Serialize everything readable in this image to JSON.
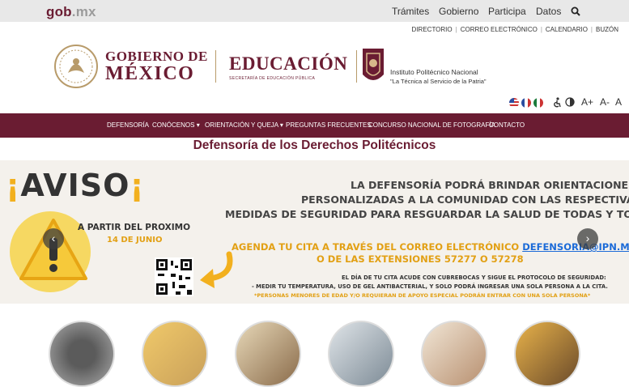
{
  "gob": {
    "brand": "gob",
    "tld": ".mx"
  },
  "topnav": {
    "tramites": "Trámites",
    "gobierno": "Gobierno",
    "participa": "Participa",
    "datos": "Datos"
  },
  "utility": [
    "DIRECTORIO",
    "CORREO ELECTRÓNICO",
    "CALENDARIO",
    "BUZÓN"
  ],
  "logos": {
    "gobierno_l1": "GOBIERNO DE",
    "gobierno_l2": "MÉXICO",
    "educacion": "EDUCACIÓN",
    "sep": "SECRETARÍA DE EDUCACIÓN PÚBLICA",
    "ipn_name": "Instituto Politécnico Nacional",
    "ipn_motto": "\"La Técnica al Servicio de la Patria\""
  },
  "accessibility": {
    "font_up": "A+",
    "font_down": "A-",
    "font_reset": "A"
  },
  "mainnav": {
    "defensoria": "DEFENSORÍA",
    "conocenos": "CONÓCENOS",
    "orientacion": "ORIENTACIÓN Y QUEJA",
    "preguntas": "PREGUNTAS FRECUENTES",
    "concurso": "CONCURSO NACIONAL DE FOTOGRAFÍA",
    "contacto": "CONTACTO"
  },
  "page_title": "Defensoría de los Derechos Politécnicos",
  "banner": {
    "aviso": "AVISO",
    "a_partir": "A PARTIR DEL PROXIMO",
    "fecha": "14 DE JUNIO",
    "line1": "LA DEFENSORÍA PODRÁ BRINDAR ORIENTACIONES",
    "line2": "PERSONALIZADAS A LA COMUNIDAD CON LAS RESPECTIVAS",
    "line3": "MEDIDAS DE SEGURIDAD PARA RESGUARDAR LA SALUD DE TODAS Y TODOS",
    "agenda": "AGENDA TU CITA A TRAVÉS DEL CORREO ELECTRÓNICO",
    "email": "DEFENSORIA@IPN.MX",
    "extensiones": "O DE LAS EXTENSIONES 57277 O 57278",
    "protocolo": "EL DÍA DE TU CITA ACUDE CON CUBREBOCAS Y SIGUE EL PROTOCOLO DE SEGURIDAD:",
    "medidas": "- MEDIR TU TEMPERATURA, USO DE GEL ANTIBACTERIAL, Y SOLO PODRÁ INGRESAR UNA SOLA PERSONA A LA CITA.",
    "menores": "*PERSONAS MENORES DE EDAD Y/O REQUIERAN DE APOYO ESPECIAL PODRÁN ENTRAR CON UNA SOLA PERSONA*",
    "prev": "‹",
    "next": "›"
  },
  "colors": {
    "brand": "#6a1c32",
    "accent": "#e2a014",
    "link": "#1c6bd8"
  }
}
